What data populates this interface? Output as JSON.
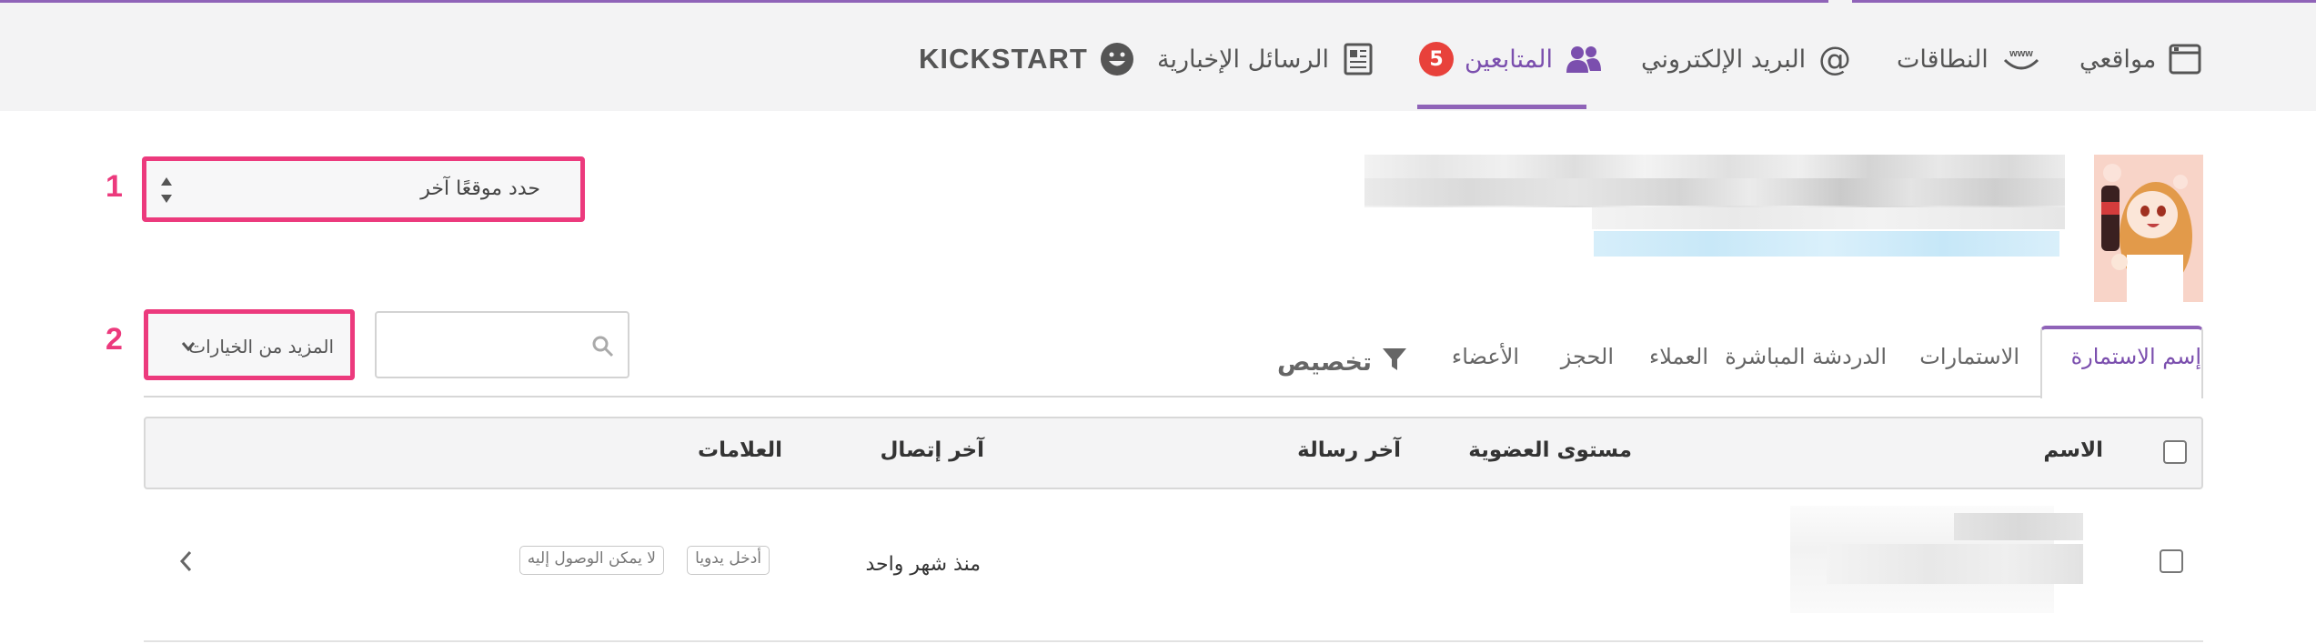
{
  "nav": {
    "items": [
      {
        "label": "مواقعي",
        "icon": "window-icon"
      },
      {
        "label": "النطاقات",
        "icon": "www-icon"
      },
      {
        "label": "البريد الإلكتروني",
        "icon": "at-sign-icon"
      },
      {
        "label": "المتابعين",
        "icon": "users-icon",
        "badge": "5",
        "active": true
      },
      {
        "label": "الرسائل الإخبارية",
        "icon": "newsletter-icon"
      },
      {
        "label": "KICKSTART",
        "icon": "smiley-icon"
      }
    ],
    "accent_color": "#8f63b8",
    "badge_color": "#e8413b"
  },
  "callouts": {
    "one": "1",
    "two": "2",
    "color": "#ec3a7d"
  },
  "site_select": {
    "value": "حدد موقعًا آخر"
  },
  "toolbar": {
    "more_options_label": "المزيد من الخيارات",
    "search_placeholder": "",
    "customize_label": "تخصيص"
  },
  "filter_tabs": [
    {
      "label": "إسم الاستمارة",
      "active": true
    },
    {
      "label": "الاستمارات"
    },
    {
      "label": "الدردشة المباشرة"
    },
    {
      "label": "العملاء"
    },
    {
      "label": "الحجز"
    },
    {
      "label": "الأعضاء"
    }
  ],
  "table": {
    "headers": {
      "name": "الاسم",
      "membership": "مستوى العضوية",
      "last_message": "آخر رسالة",
      "last_contact": "آخر إتصال",
      "tags": "العلامات"
    },
    "rows": [
      {
        "last_contact": "منذ شهر واحد",
        "tags": [
          "أدخل يدويا",
          "لا يمكن الوصول إليه"
        ]
      }
    ]
  }
}
